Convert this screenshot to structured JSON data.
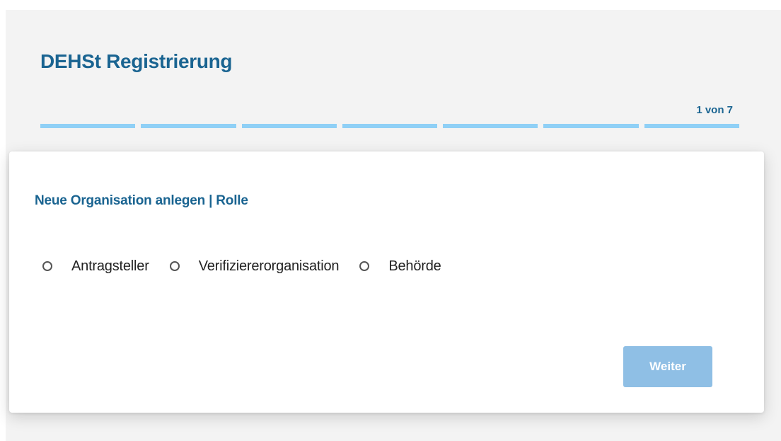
{
  "header": {
    "title": "DEHSt Registrierung",
    "step_counter": "1 von 7",
    "total_steps": 7,
    "current_step": 1
  },
  "form": {
    "section_title": "Neue Organisation anlegen | Rolle",
    "role_options": [
      {
        "label": "Antragsteller",
        "selected": false
      },
      {
        "label": "Verifiziererorganisation",
        "selected": false
      },
      {
        "label": "Behörde",
        "selected": false
      }
    ],
    "next_label": "Weiter",
    "next_enabled": false
  },
  "colors": {
    "title": "#1a6491",
    "progress_segment": "#8fd0f6",
    "button_disabled": "#8fbfe5",
    "page_background": "#f3f3f3"
  }
}
